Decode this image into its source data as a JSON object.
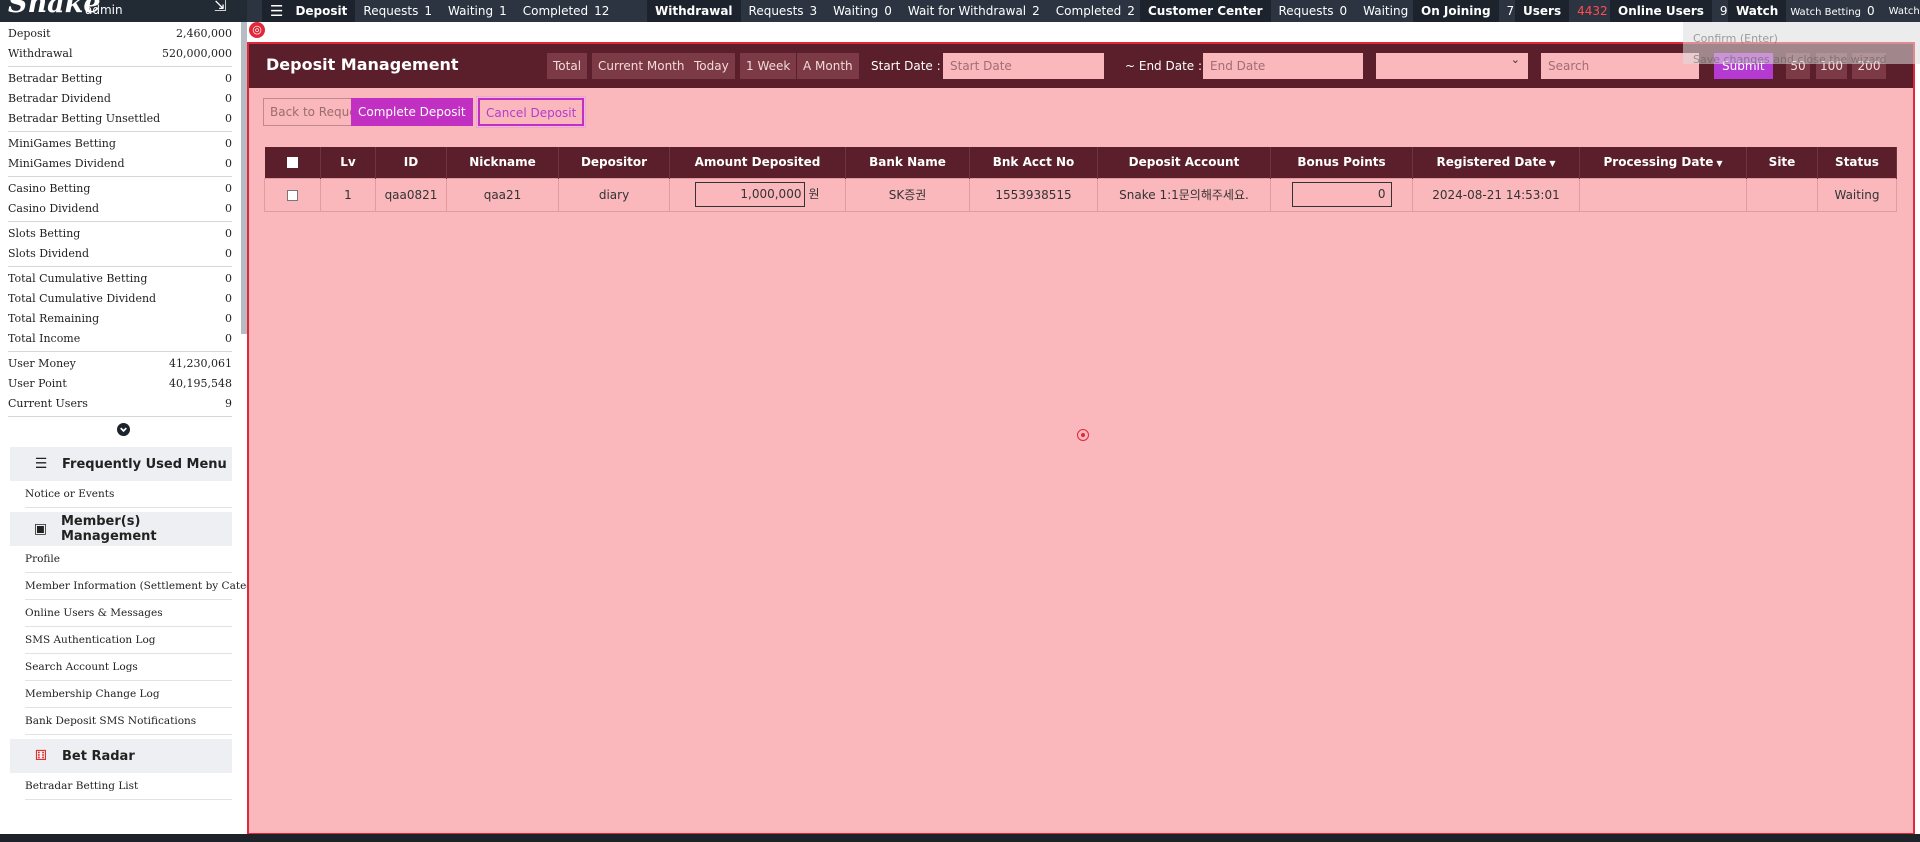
{
  "brand": {
    "logo": "Snake",
    "user": "admin",
    "logout_icon": "sign-out-icon"
  },
  "topbar": {
    "menu_icon": "☰",
    "deposit": {
      "title": "Deposit",
      "requests_label": "Requests",
      "requests": "1",
      "waiting_label": "Waiting",
      "waiting": "1",
      "completed_label": "Completed",
      "completed": "12"
    },
    "withdrawal": {
      "title": "Withdrawal",
      "requests_label": "Requests",
      "requests": "3",
      "waiting_label": "Waiting",
      "waiting": "0",
      "wait_label": "Wait for Withdrawal",
      "wait": "2",
      "completed_label": "Completed",
      "completed": "2"
    },
    "customer": {
      "title": "Customer Center",
      "requests_label": "Requests",
      "requests": "0",
      "waiting_label": "Waiting",
      "waiting": "0"
    },
    "joining": {
      "title": "On Joining",
      "value": "7"
    },
    "users": {
      "title": "Users",
      "value": "4432"
    },
    "online": {
      "title": "Online Users",
      "value": "9"
    },
    "watch": {
      "title": "Watch",
      "betting_label": "Watch Betting",
      "betting": "0",
      "extra": "Watch"
    }
  },
  "sidebar": {
    "stats": [
      [
        {
          "label": "Deposit",
          "value": "2,460,000"
        },
        {
          "label": "Withdrawal",
          "value": "520,000,000"
        }
      ],
      [
        {
          "label": "Betradar Betting",
          "value": "0"
        },
        {
          "label": "Betradar Dividend",
          "value": "0"
        },
        {
          "label": "Betradar Betting Unsettled",
          "value": "0"
        }
      ],
      [
        {
          "label": "MiniGames Betting",
          "value": "0"
        },
        {
          "label": "MiniGames Dividend",
          "value": "0"
        }
      ],
      [
        {
          "label": "Casino Betting",
          "value": "0"
        },
        {
          "label": "Casino Dividend",
          "value": "0"
        }
      ],
      [
        {
          "label": "Slots Betting",
          "value": "0"
        },
        {
          "label": "Slots Dividend",
          "value": "0"
        }
      ],
      [
        {
          "label": "Total Cumulative Betting",
          "value": "0"
        },
        {
          "label": "Total Cumulative Dividend",
          "value": "0"
        },
        {
          "label": "Total Remaining",
          "value": "0"
        },
        {
          "label": "Total Income",
          "value": "0"
        }
      ],
      [
        {
          "label": "User Money",
          "value": "41,230,061"
        },
        {
          "label": "User Point",
          "value": "40,195,548"
        },
        {
          "label": "Current Users",
          "value": "9"
        }
      ]
    ],
    "expand_icon": "chevron-down-icon",
    "menus": {
      "frequent": {
        "icon": "☰",
        "title": "Frequently Used Menu",
        "items": [
          "Notice or Events"
        ]
      },
      "members": {
        "icon": "▣",
        "title": "Member(s) Management",
        "items": [
          "Profile",
          "Member Information (Settlement by Category)",
          "Online Users & Messages",
          "SMS Authentication Log",
          "Search Account Logs",
          "Membership Change Log",
          "Bank Deposit SMS Notifications"
        ]
      },
      "betradar": {
        "icon": "⚅",
        "title": "Bet Radar",
        "items": [
          "Betradar Betting List"
        ]
      }
    }
  },
  "main": {
    "title": "Deposit Management",
    "filters": {
      "total": "Total",
      "current_month": "Current Month",
      "today": "Today",
      "one_week": "1 Week",
      "a_month": "A Month"
    },
    "start_label": "Start Date :",
    "start_placeholder": "Start Date",
    "end_label": "~ End Date :",
    "end_placeholder": "End Date",
    "select_value": "",
    "search_placeholder": "Search",
    "submit": "Submit",
    "page_sizes": [
      "50",
      "100",
      "200"
    ],
    "actions": {
      "back": "Back to Request",
      "complete": "Complete Deposit",
      "cancel": "Cancel Deposit"
    },
    "columns": [
      "Lv",
      "ID",
      "Nickname",
      "Depositor",
      "Amount Deposited",
      "Bank Name",
      "Bnk Acct No",
      "Deposit Account",
      "Bonus Points",
      "Registered Date",
      "Processing Date",
      "Site",
      "Status"
    ],
    "rows": [
      {
        "lv": "1",
        "id": "qaa0821",
        "nickname": "qaa21",
        "depositor": "diary",
        "amount": "1,000,000",
        "currency": "원",
        "bank": "SK증권",
        "acct_no": "1553938515",
        "deposit_account": "Snake 1:1문의해주세요.",
        "bonus": "0",
        "registered": "2024-08-21 14:53:01",
        "processing": "",
        "site": "",
        "status": "Waiting"
      }
    ]
  },
  "ghost_tooltip": {
    "line1": "Confirm (Enter)",
    "line2": "Save changes and close the wizard"
  }
}
